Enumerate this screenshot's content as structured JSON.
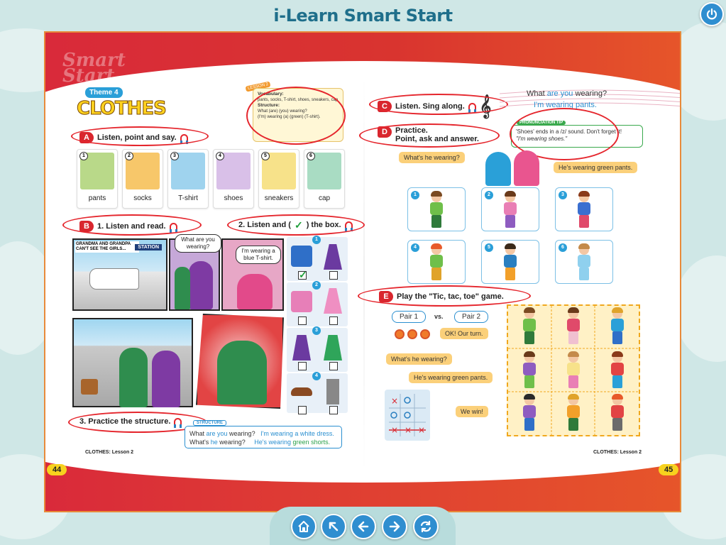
{
  "app": {
    "title": "i-Learn Smart Start"
  },
  "left_page": {
    "logo_text": "Smart Start",
    "theme_badge": "Theme 4",
    "unit_title": "CLOTHES",
    "lesson_tag": "LESSON 2",
    "vocab": {
      "vocab_label": "Vocabulary:",
      "vocab_words": "pants, socks, T-shirt, shoes, sneakers, cap",
      "structure_label": "Structure:",
      "structure_q": "What (are) (you) wearing?",
      "structure_a": "(I'm) wearing (a) (green) (T-shirt)."
    },
    "section_a": {
      "letter": "A",
      "title": "Listen, point and say.",
      "cards": [
        {
          "num": "1",
          "word": "pants",
          "color": "#b9d989"
        },
        {
          "num": "2",
          "word": "socks",
          "color": "#f7c76a"
        },
        {
          "num": "3",
          "word": "T-shirt",
          "color": "#9fd3ee"
        },
        {
          "num": "4",
          "word": "shoes",
          "color": "#d9c0e8"
        },
        {
          "num": "5",
          "word": "sneakers",
          "color": "#f7e28a"
        },
        {
          "num": "6",
          "word": "cap",
          "color": "#a9dcc3"
        }
      ]
    },
    "section_b": {
      "letter": "B",
      "title_1": "1. Listen and read.",
      "title_2_pre": "2. Listen and (",
      "title_2_post": ") the box.",
      "comic_caption": "GRANDMA AND GRANDPA CAN'T SEE THE GIRLS...",
      "station_sign": "STATION",
      "bubble_1": "What are you wearing?",
      "bubble_2": "I'm wearing a blue T-shirt.",
      "box_numbers": [
        "1",
        "2",
        "3",
        "4"
      ]
    },
    "practice": {
      "title": "3. Practice the structure.",
      "structure_tag": "STRUCTURE",
      "line1_q_a": "What ",
      "line1_q_b": "are you",
      "line1_q_c": " wearing?",
      "line1_a_a": "I'm wearing ",
      "line1_a_b": "a white dress.",
      "line2_q_a": "What's ",
      "line2_q_b": "he",
      "line2_q_c": " wearing?",
      "line2_a_a": "He's wearing ",
      "line2_a_b": "green shorts."
    },
    "footer_lesson": "CLOTHES: Lesson 2",
    "page_number": "44"
  },
  "right_page": {
    "section_c": {
      "letter": "C",
      "title": "Listen. Sing along.",
      "song_line_1a": "What ",
      "song_line_1b": "are you",
      "song_line_1c": " wearing?",
      "song_line_2": "I'm wearing pants."
    },
    "pronunciation": {
      "tag": "PRONUNCIATION TIP",
      "text_1": "'Shoes' ends in a /z/ sound. Don't forget it!",
      "text_2": "\"I'm wearing shoes.\""
    },
    "section_d": {
      "letter": "D",
      "title_1": "Practice.",
      "title_2": "Point, ask and answer.",
      "bubble_q": "What's he wearing?",
      "bubble_a": "He's wearing green pants.",
      "kid_numbers": [
        "1",
        "2",
        "3",
        "4",
        "5",
        "6"
      ]
    },
    "section_e": {
      "letter": "E",
      "title": "Play the \"Tic, tac, toe\" game.",
      "pair_1": "Pair 1",
      "vs": "vs.",
      "pair_2": "Pair 2",
      "turn_bubble": "OK! Our turn.",
      "bubble_q": "What's he wearing?",
      "bubble_a": "He's wearing green pants.",
      "win_bubble": "We win!"
    },
    "footer_lesson": "CLOTHES: Lesson 2",
    "page_number": "45"
  },
  "toolbar": {
    "buttons": [
      "home-icon",
      "first-page-icon",
      "previous-icon",
      "next-icon",
      "refresh-icon"
    ]
  },
  "colors": {
    "banner_red": "#d92a3a",
    "accent_blue": "#2f8ed0",
    "title_blue": "#1f6f8b"
  }
}
